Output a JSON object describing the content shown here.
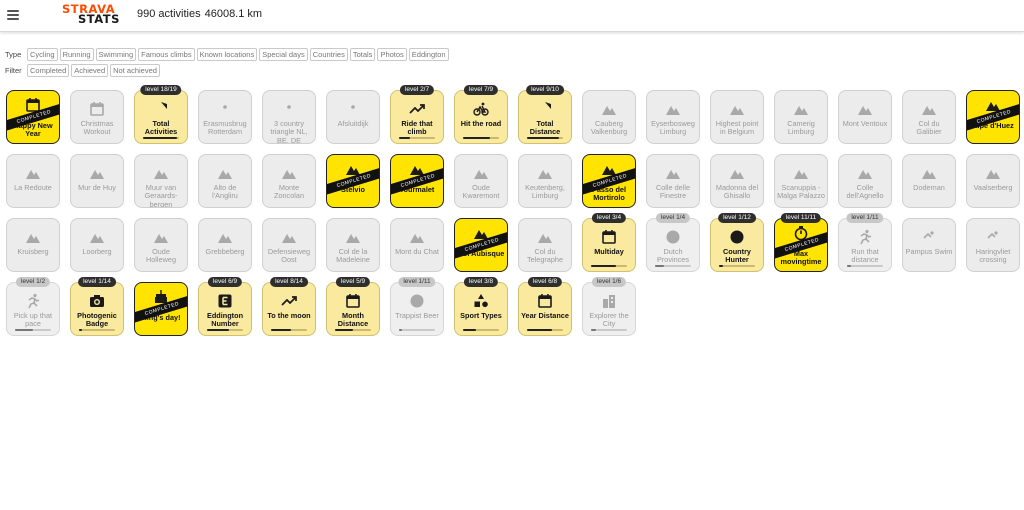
{
  "header": {
    "logo_top": "STRAVA",
    "logo_bottom": "STATS",
    "activities": "990 activities",
    "distance": "46008.1 km"
  },
  "filters": {
    "type_label": "Type",
    "types": [
      "Cycling",
      "Running",
      "Swimming",
      "Famous climbs",
      "Known locations",
      "Special days",
      "Countries",
      "Totals",
      "Photos",
      "Eddington"
    ],
    "filter_label": "Filter",
    "states": [
      "Completed",
      "Achieved",
      "Not achieved"
    ]
  },
  "completed_text": "COMPLETED",
  "colors": {
    "completed": "#ffe400",
    "in_progress": "#faeaa0",
    "not_achieved": "#ececec",
    "strava_orange": "#fc4c02"
  },
  "badges": [
    {
      "label": "Happy New Year",
      "icon": "calendar-icon",
      "state": "done"
    },
    {
      "label": "Christmas Workout",
      "icon": "calendar-icon",
      "state": "none"
    },
    {
      "label": "Total Activities",
      "icon": "shield-check-icon",
      "state": "prog",
      "level": "level 18/19",
      "progress": 0.95
    },
    {
      "label": "Erasmusbrug Rotterdam",
      "icon": "location-pin-icon",
      "state": "none"
    },
    {
      "label": "3 country triangle NL, BE, DE",
      "icon": "location-pin-icon",
      "state": "none"
    },
    {
      "label": "Afsluitdijk",
      "icon": "location-pin-icon",
      "state": "none"
    },
    {
      "label": "Ride that climb",
      "icon": "trend-up-icon",
      "state": "prog",
      "level": "level 2/7",
      "progress": 0.3
    },
    {
      "label": "Hit the road",
      "icon": "bicycle-icon",
      "state": "prog",
      "level": "level 7/9",
      "progress": 0.75
    },
    {
      "label": "Total Distance",
      "icon": "shield-check-icon",
      "state": "prog",
      "level": "level 9/10",
      "progress": 0.9
    },
    {
      "label": "Cauberg Valkenburg",
      "icon": "mountain-icon",
      "state": "none"
    },
    {
      "label": "Eyserbosweg Limburg",
      "icon": "mountain-icon",
      "state": "none"
    },
    {
      "label": "Highest point in Belgium",
      "icon": "mountain-icon",
      "state": "none"
    },
    {
      "label": "Camerig Limburg",
      "icon": "mountain-icon",
      "state": "none"
    },
    {
      "label": "Mont Ventoux",
      "icon": "mountain-icon",
      "state": "none"
    },
    {
      "label": "Col du Galibier",
      "icon": "mountain-icon",
      "state": "none"
    },
    {
      "label": "Alpe d'Huez",
      "icon": "mountain-icon",
      "state": "done"
    },
    {
      "label": "La Redoute",
      "icon": "mountain-icon",
      "state": "none"
    },
    {
      "label": "Mur de Huy",
      "icon": "mountain-icon",
      "state": "none"
    },
    {
      "label": "Muur van Geraards-bergen",
      "icon": "mountain-icon",
      "state": "none"
    },
    {
      "label": "Alto de l'Angliru",
      "icon": "mountain-icon",
      "state": "none"
    },
    {
      "label": "Monte Zoncolan",
      "icon": "mountain-icon",
      "state": "none"
    },
    {
      "label": "Stelvio",
      "icon": "mountain-icon",
      "state": "done"
    },
    {
      "label": "Tourmalet",
      "icon": "mountain-icon",
      "state": "done"
    },
    {
      "label": "Oude Kwaremont",
      "icon": "mountain-icon",
      "state": "none"
    },
    {
      "label": "Keutenberg, Limburg",
      "icon": "mountain-icon",
      "state": "none"
    },
    {
      "label": "Passo del Mortirolo",
      "icon": "mountain-icon",
      "state": "done"
    },
    {
      "label": "Colle delle Finestre",
      "icon": "mountain-icon",
      "state": "none"
    },
    {
      "label": "Madonna del Ghisallo",
      "icon": "mountain-icon",
      "state": "none"
    },
    {
      "label": "Scanuppia - Malga Palazzo",
      "icon": "mountain-icon",
      "state": "none"
    },
    {
      "label": "Colle dell'Agnello",
      "icon": "mountain-icon",
      "state": "none"
    },
    {
      "label": "Dodeman",
      "icon": "mountain-icon",
      "state": "none"
    },
    {
      "label": "Vaalserberg",
      "icon": "mountain-icon",
      "state": "none"
    },
    {
      "label": "Kruisberg",
      "icon": "mountain-icon",
      "state": "none"
    },
    {
      "label": "Loorberg",
      "icon": "mountain-icon",
      "state": "none"
    },
    {
      "label": "Oude Holleweg",
      "icon": "mountain-icon",
      "state": "none"
    },
    {
      "label": "Grebbeberg",
      "icon": "mountain-icon",
      "state": "none"
    },
    {
      "label": "Defensieweg Oost",
      "icon": "mountain-icon",
      "state": "none"
    },
    {
      "label": "Col de la Madeleine",
      "icon": "mountain-icon",
      "state": "none"
    },
    {
      "label": "Mont du Chat",
      "icon": "mountain-icon",
      "state": "none"
    },
    {
      "label": "Col Aubisque",
      "icon": "mountain-icon",
      "state": "done"
    },
    {
      "label": "Col du Telegraphe",
      "icon": "mountain-icon",
      "state": "none"
    },
    {
      "label": "Multiday",
      "icon": "calendar-icon",
      "state": "prog",
      "level": "level 3/4",
      "progress": 0.7
    },
    {
      "label": "Dutch Provinces",
      "icon": "globe-icon",
      "state": "muted",
      "level": "level 1/4",
      "progress": 0.25
    },
    {
      "label": "Country Hunter",
      "icon": "globe-icon",
      "state": "prog",
      "level": "level 1/12",
      "progress": 0.12
    },
    {
      "label": "Max movingtime",
      "icon": "stopwatch-icon",
      "state": "done",
      "level": "level 11/11",
      "progress": 1
    },
    {
      "label": "Run that distance",
      "icon": "runner-icon",
      "state": "muted",
      "level": "level 1/11",
      "progress": 0.1
    },
    {
      "label": "Pampus Swim",
      "icon": "swimmer-icon",
      "state": "none"
    },
    {
      "label": "Haringvliet crossing",
      "icon": "swimmer-icon",
      "state": "none"
    },
    {
      "label": "Pick up that pace",
      "icon": "runner-icon",
      "state": "muted",
      "level": "level 1/2",
      "progress": 0.5
    },
    {
      "label": "Photogenic Badge",
      "icon": "camera-icon",
      "state": "prog",
      "level": "level 1/14",
      "progress": 0.07
    },
    {
      "label": "King's day!",
      "icon": "cake-icon",
      "state": "done"
    },
    {
      "label": "Eddington Number",
      "icon": "letter-e-icon",
      "state": "prog",
      "level": "level 6/9",
      "progress": 0.6
    },
    {
      "label": "To the moon",
      "icon": "trend-up-icon",
      "state": "prog",
      "level": "level 8/14",
      "progress": 0.55
    },
    {
      "label": "Month Distance",
      "icon": "calendar-icon",
      "state": "prog",
      "level": "level 5/9",
      "progress": 0.5
    },
    {
      "label": "Trappist Beer",
      "icon": "globe-icon",
      "state": "muted",
      "level": "level 1/11",
      "progress": 0.09
    },
    {
      "label": "Sport Types",
      "icon": "shapes-icon",
      "state": "prog",
      "level": "level 3/8",
      "progress": 0.35
    },
    {
      "label": "Year Distance",
      "icon": "calendar-icon",
      "state": "prog",
      "level": "level 6/8",
      "progress": 0.7
    },
    {
      "label": "Explorer the City",
      "icon": "buildings-icon",
      "state": "muted",
      "level": "level 1/6",
      "progress": 0.15
    }
  ]
}
